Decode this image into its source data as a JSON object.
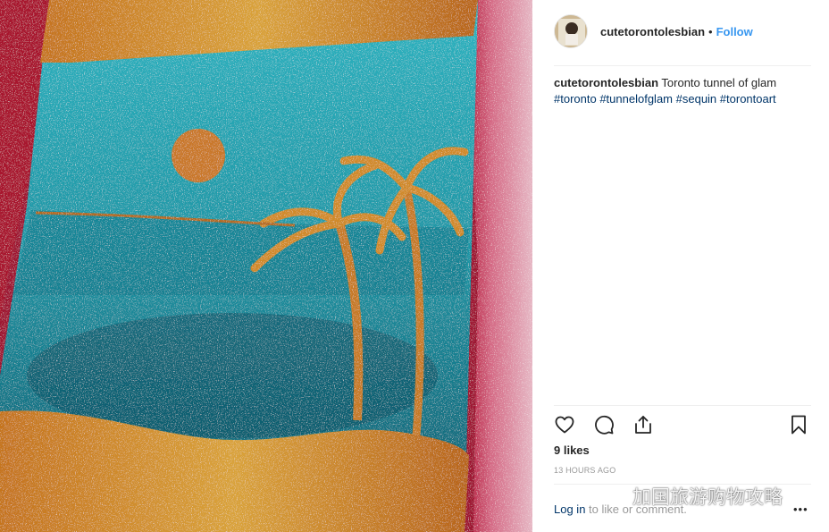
{
  "post": {
    "username": "cutetorontolesbian",
    "separator": "•",
    "follow_label": "Follow",
    "caption_username": "cutetorontolesbian",
    "caption_text": "Toronto tunnel of glam",
    "hashtags": [
      "#toronto",
      "#tunnelofglam",
      "#sequin",
      "#torontoart"
    ],
    "likes": "9 likes",
    "timestamp": "13 HOURS AGO",
    "login_link": "Log in",
    "login_suffix": " to like or comment.",
    "more_label": "•••"
  },
  "watermark": {
    "text": "加国旅游购物攻略"
  },
  "colors": {
    "link_blue": "#3897f0",
    "tag_navy": "#003569",
    "muted": "#999999",
    "divider": "#efefef"
  },
  "icons": [
    "heart-icon",
    "comment-icon",
    "share-icon",
    "bookmark-icon",
    "avatar",
    "wechat-icon"
  ]
}
